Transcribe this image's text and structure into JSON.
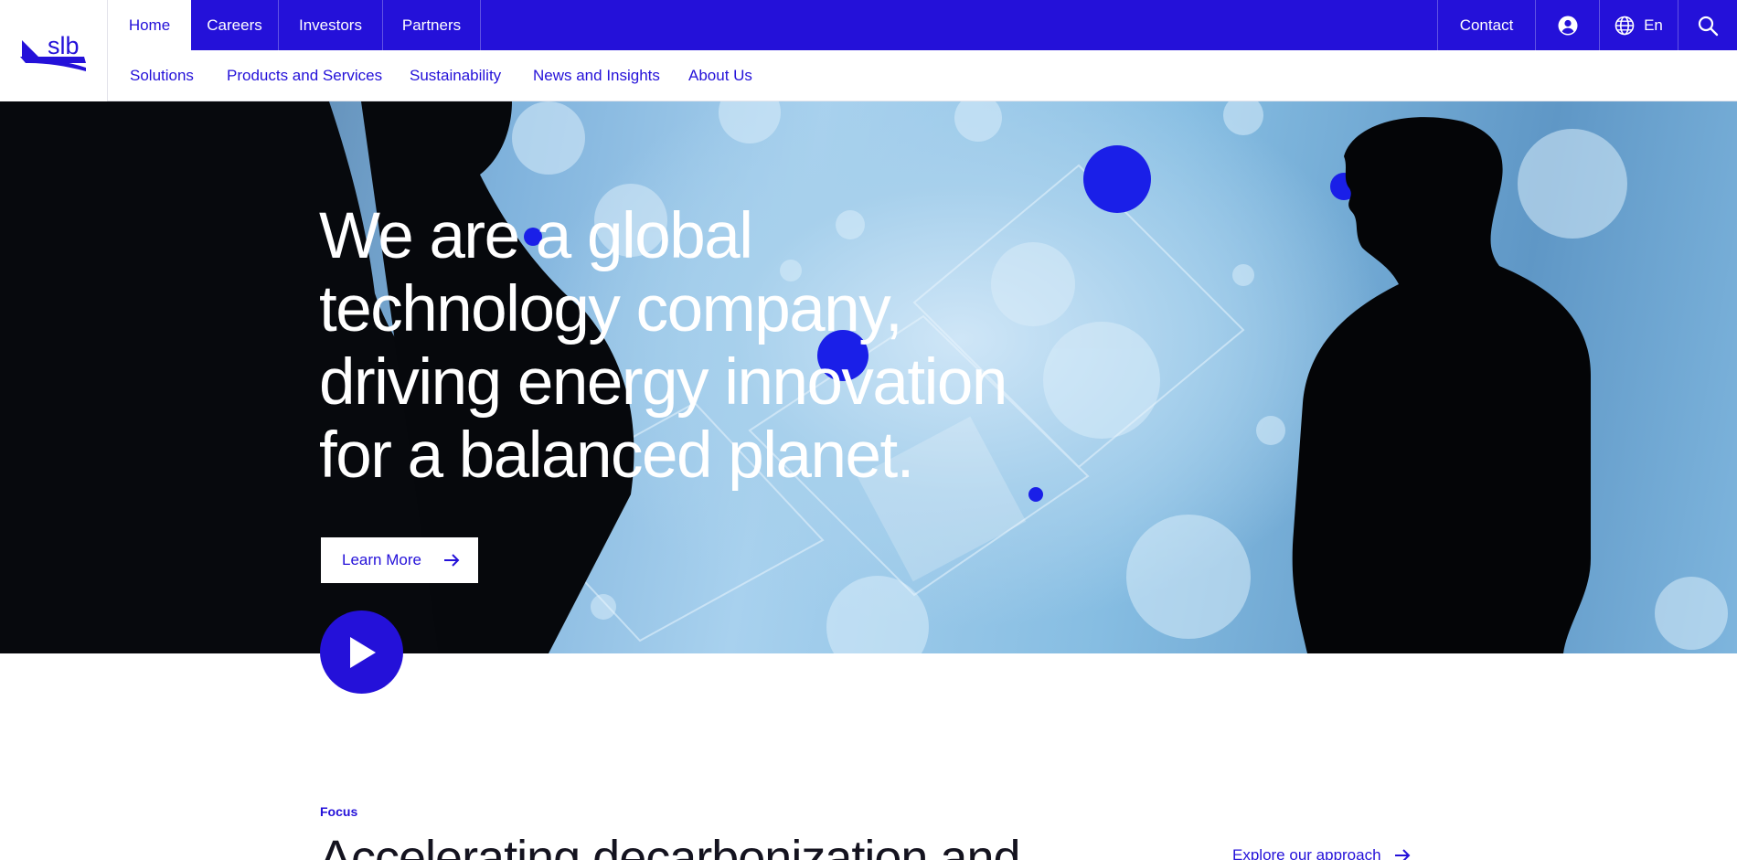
{
  "brand": {
    "logo_text": "slb",
    "accent": "#2411d9"
  },
  "topnav": {
    "tabs": [
      {
        "label": "Home",
        "active": true
      },
      {
        "label": "Careers"
      },
      {
        "label": "Investors"
      },
      {
        "label": "Partners"
      }
    ],
    "contact_label": "Contact",
    "account_icon": "user-circle-icon",
    "language": {
      "icon": "globe-icon",
      "label": "En"
    },
    "search_icon": "search-icon"
  },
  "subnav": {
    "items": [
      {
        "label": "Solutions"
      },
      {
        "label": "Products and Services"
      },
      {
        "label": "Sustainability"
      },
      {
        "label": "News and Insights"
      },
      {
        "label": "About Us"
      }
    ]
  },
  "hero": {
    "headline_lines": [
      "We are a global",
      "technology company,",
      "driving energy innovation",
      "for a balanced planet."
    ],
    "cta_label": "Learn More",
    "cta_icon": "arrow-right-icon",
    "play_icon": "play-icon"
  },
  "focus": {
    "label": "Focus",
    "title": "Accelerating decarbonization and",
    "link_label": "Explore our approach",
    "link_icon": "arrow-right-icon"
  }
}
